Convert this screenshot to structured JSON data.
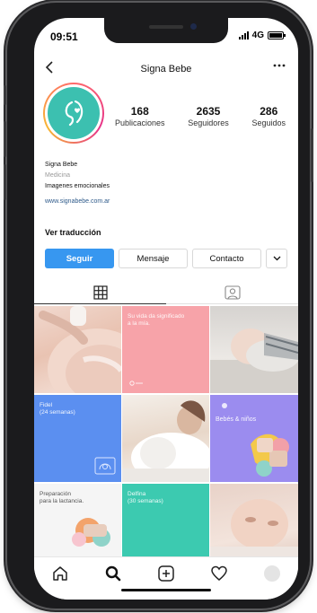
{
  "status": {
    "time": "09:51",
    "network": "4G"
  },
  "nav": {
    "title": "Signa Bebe"
  },
  "profile": {
    "posts_count": "168",
    "posts_label": "Publicaciones",
    "followers_count": "2635",
    "followers_label": "Seguidores",
    "following_count": "286",
    "following_label": "Seguidos",
    "name": "Signa Bebe",
    "category": "Medicina",
    "bio": "Imagenes emocionales",
    "website": "www.signabebe.com.ar",
    "translate": "Ver traducción"
  },
  "actions": {
    "follow": "Seguir",
    "message": "Mensaje",
    "contact": "Contacto"
  },
  "grid": {
    "pink_caption_1": "Su vida da significado",
    "pink_caption_2": "a la mía.",
    "blue_caption_1": "Fidel",
    "blue_caption_2": "(24 semanas)",
    "purple_caption": "Bebés & niños",
    "white_caption_1": "Preparación",
    "white_caption_2": "para la lactancia.",
    "teal_caption_1": "Delfina",
    "teal_caption_2": "(30 semanas)"
  },
  "colors": {
    "accent": "#3797f0",
    "avatar": "#3cc0b0",
    "pink_tile": "#f7a3a9",
    "blue_tile": "#5b8ff0",
    "purple_tile": "#9b8cef",
    "teal_tile": "#3ccab0"
  }
}
